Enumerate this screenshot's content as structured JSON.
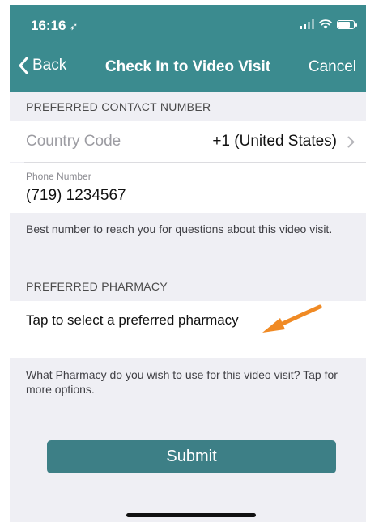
{
  "status_bar": {
    "time": "16:16",
    "location_glyph": "➶"
  },
  "nav": {
    "back_label": "Back",
    "title": "Check In to Video Visit",
    "cancel_label": "Cancel"
  },
  "contact": {
    "section_header": "PREFERRED CONTACT NUMBER",
    "country_code_label": "Country Code",
    "country_code_value": "+1 (United States)",
    "phone_label": "Phone Number",
    "phone_value": "(719) 1234567",
    "helper": "Best number to reach you for questions about this video visit."
  },
  "pharmacy": {
    "section_header": "PREFERRED PHARMACY",
    "select_label": "Tap to select a preferred pharmacy",
    "helper": "What Pharmacy do you wish to use for this video visit? Tap for more options."
  },
  "submit_label": "Submit",
  "colors": {
    "nav_bar": "#3b8b8f",
    "button": "#3d7f86",
    "arrow": "#f08a24",
    "background": "#efeff4"
  },
  "icons": [
    "location-arrow-icon",
    "signal-icon",
    "wifi-icon",
    "battery-icon",
    "chevron-left-icon",
    "chevron-right-icon",
    "pointer-arrow-icon"
  ]
}
